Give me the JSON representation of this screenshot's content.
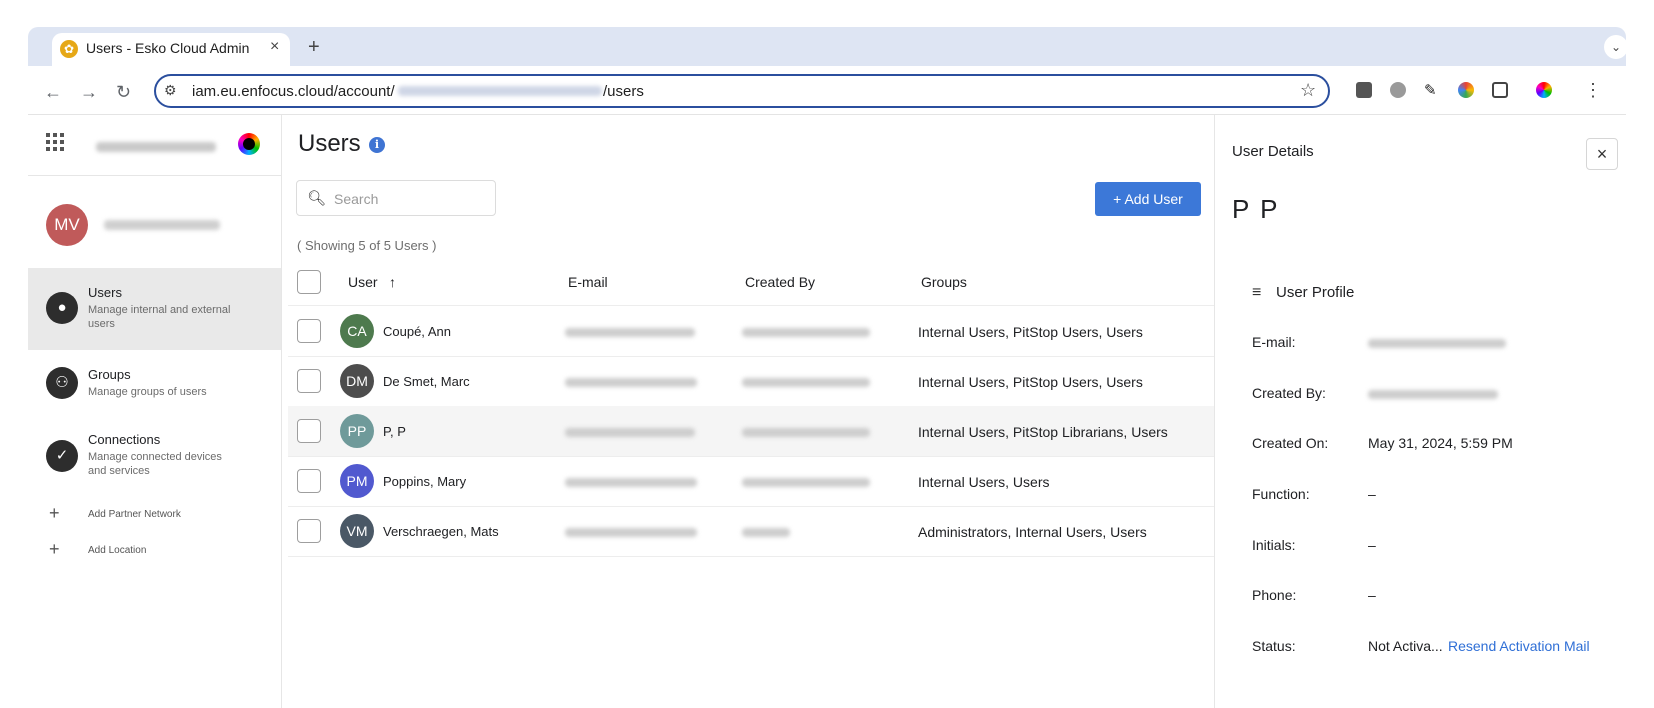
{
  "browser": {
    "tab_title": "Users - Esko Cloud Admin",
    "tab_close": "×",
    "new_tab": "+",
    "url_prefix": "iam.eu.enfocus.cloud/account/",
    "url_suffix": "/users"
  },
  "sidebar": {
    "items": [
      {
        "label": "Users",
        "description": "Manage internal and external users"
      },
      {
        "label": "Groups",
        "description": "Manage groups of users"
      },
      {
        "label": "Connections",
        "description": "Manage connected devices and services"
      }
    ],
    "extra_links": [
      {
        "label": "Add Partner Network"
      },
      {
        "label": "Add Location"
      }
    ],
    "user_initials": "MV"
  },
  "main": {
    "title": "Users",
    "search_placeholder": "Search",
    "add_user_label": "+ Add User",
    "showing_text": "( Showing 5 of 5 Users )",
    "columns": [
      "User",
      "E-mail",
      "Created By",
      "Groups"
    ],
    "sort_indicator": "↑",
    "rows": [
      {
        "initials": "CA",
        "name": "Coupé, Ann",
        "groups": "Internal Users, PitStop Users, Users",
        "avatar_color": "#4e7a4e"
      },
      {
        "initials": "DM",
        "name": "De Smet, Marc",
        "groups": "Internal Users, PitStop Users, Users",
        "avatar_color": "#4d4d4d"
      },
      {
        "initials": "PP",
        "name": "P, P",
        "groups": "Internal Users, PitStop Librarians, Users",
        "avatar_color": "#6f9a9a"
      },
      {
        "initials": "PM",
        "name": "Poppins, Mary",
        "groups": "Internal Users, Users",
        "avatar_color": "#5159cf"
      },
      {
        "initials": "VM",
        "name": "Verschraegen, Mats",
        "groups": "Administrators, Internal Users, Users",
        "avatar_color": "#4a5866"
      }
    ]
  },
  "details": {
    "title": "User Details",
    "close": "×",
    "name": "P P",
    "profile_title": "User Profile",
    "fields": [
      {
        "label": "E-mail:",
        "value": ""
      },
      {
        "label": "Created By:",
        "value": ""
      },
      {
        "label": "Created On:",
        "value": "May 31, 2024, 5:59 PM"
      },
      {
        "label": "Function:",
        "value": "–"
      },
      {
        "label": "Initials:",
        "value": "–"
      },
      {
        "label": "Phone:",
        "value": "–"
      },
      {
        "label": "Status:",
        "value": "Not Activa..."
      }
    ],
    "resend_link": "Resend Activation Mail"
  },
  "colors": {
    "accent": "#3c78d8",
    "link": "#2f6fd6",
    "info": "#3f74d3"
  }
}
